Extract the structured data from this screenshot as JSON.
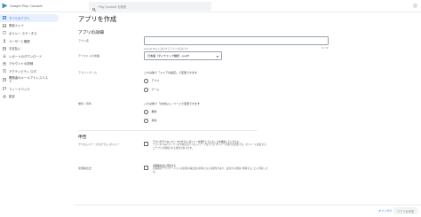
{
  "app": {
    "brand": "Google Play Console"
  },
  "search": {
    "placeholder": "Play Console を検索"
  },
  "sidebar": {
    "items": [
      {
        "label": "すべてのアプリ",
        "active": true
      },
      {
        "label": "受信トレイ"
      },
      {
        "label": "ポリシー ステータス"
      },
      {
        "label": "ユーザーと権限"
      },
      {
        "label": "お支払い"
      },
      {
        "label": "レポートのダウンロード"
      },
      {
        "label": "アカウントの詳細"
      },
      {
        "label": "アクティビティ ログ"
      },
      {
        "label": "開発者のメールアドレスリスト"
      },
      {
        "label": "フィードバック"
      },
      {
        "label": "設定"
      }
    ]
  },
  "main": {
    "title": "アプリを作成",
    "details_heading": "アプリの詳細",
    "app_name": {
      "label": "アプリ名",
      "value": "",
      "hint": "Google Play に表示するアプリの名前です",
      "counter": "0 / 30"
    },
    "default_language": {
      "label": "デフォルトの言語",
      "value": "日本語（ダイナミック翻訳 – ja-JP）"
    },
    "app_or_game": {
      "label": "アプリ / ゲーム",
      "prompt": "これは後で「ストアの設定」で変更できます",
      "options": [
        "アプリ",
        "ゲーム"
      ]
    },
    "free_or_paid": {
      "label": "無料 / 有料",
      "prompt": "これは後で「お支払い」ページで変更できます",
      "options": [
        "無料",
        "有料"
      ]
    },
    "declarations_heading": "申告",
    "policy": {
      "label": "デベロッパー プログラム ポリシー",
      "heading": "アプリがデベロッパー プログラム ポリシーを遵守していることを確認してください",
      "body": "アプリの Play ストアへの公開にはデベロッパー プログラム ポリシーの遵守が必要です。ポリシーに違反するとアプリが削除される場合があります。"
    },
    "export_laws": {
      "label": "米国輸出法",
      "heading": "米国輸出法に同意する",
      "body": "お客様のアプリケーションは米国の輸出法の対象となる可能性があり、該当する規制に準拠することに同意します。"
    }
  },
  "footer": {
    "cancel_label": "キャンセル",
    "create_label": "アプリを作成"
  },
  "colors": {
    "accent": "#1a73e8",
    "active_bg": "#e8f0fe"
  }
}
